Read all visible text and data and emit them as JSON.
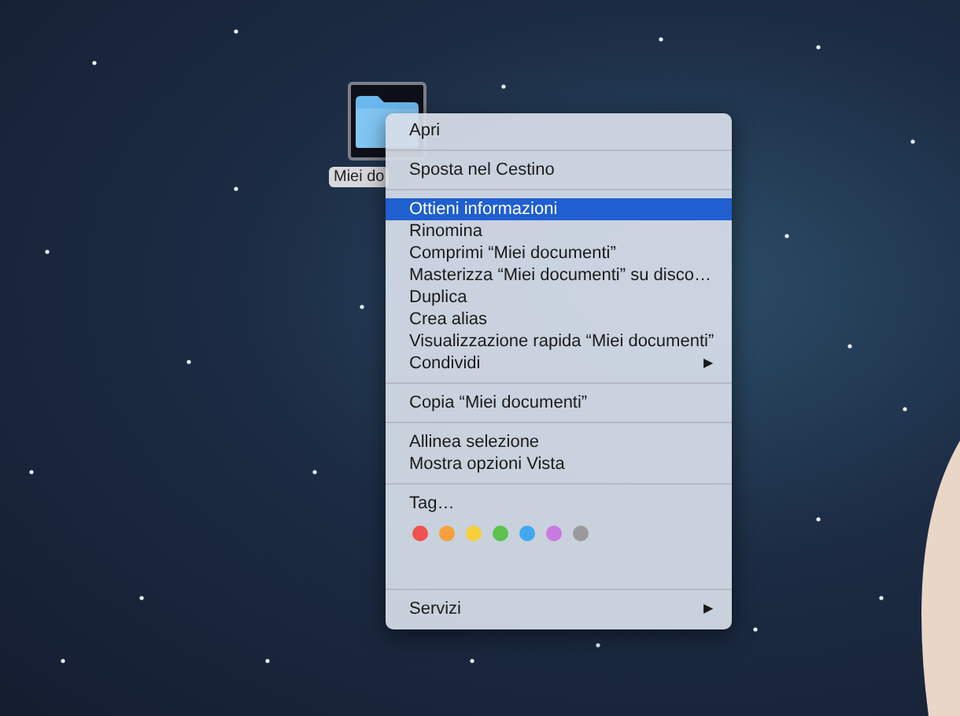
{
  "desktop_icon": {
    "label": "Miei do",
    "selected": true
  },
  "context_menu": {
    "sections": [
      {
        "items": [
          {
            "label": "Apri",
            "selected": false
          }
        ]
      },
      {
        "items": [
          {
            "label": "Sposta nel Cestino",
            "selected": false
          }
        ]
      },
      {
        "items": [
          {
            "label": "Ottieni informazioni",
            "selected": true
          },
          {
            "label": "Rinomina",
            "selected": false
          },
          {
            "label": "Comprimi “Miei documenti”",
            "selected": false
          },
          {
            "label": "Masterizza “Miei documenti” su disco…",
            "selected": false
          },
          {
            "label": "Duplica",
            "selected": false
          },
          {
            "label": "Crea alias",
            "selected": false
          },
          {
            "label": "Visualizzazione rapida “Miei documenti”",
            "selected": false
          },
          {
            "label": "Condividi",
            "selected": false,
            "submenu": "▶"
          }
        ]
      },
      {
        "items": [
          {
            "label": "Copia “Miei documenti”",
            "selected": false
          }
        ]
      },
      {
        "items": [
          {
            "label": "Allinea selezione",
            "selected": false
          },
          {
            "label": "Mostra opzioni Vista",
            "selected": false
          }
        ]
      },
      {
        "items": [
          {
            "label": "Tag…",
            "selected": false
          }
        ],
        "tags": [
          {
            "color": "#f0524f"
          },
          {
            "color": "#f5a03c"
          },
          {
            "color": "#f5d03a"
          },
          {
            "color": "#5cc34f"
          },
          {
            "color": "#42a8f0"
          },
          {
            "color": "#c87ae0"
          },
          {
            "color": "#9a9a9e"
          }
        ]
      },
      {
        "items": [
          {
            "label": "Servizi",
            "selected": false,
            "submenu": "▶"
          }
        ]
      }
    ]
  }
}
